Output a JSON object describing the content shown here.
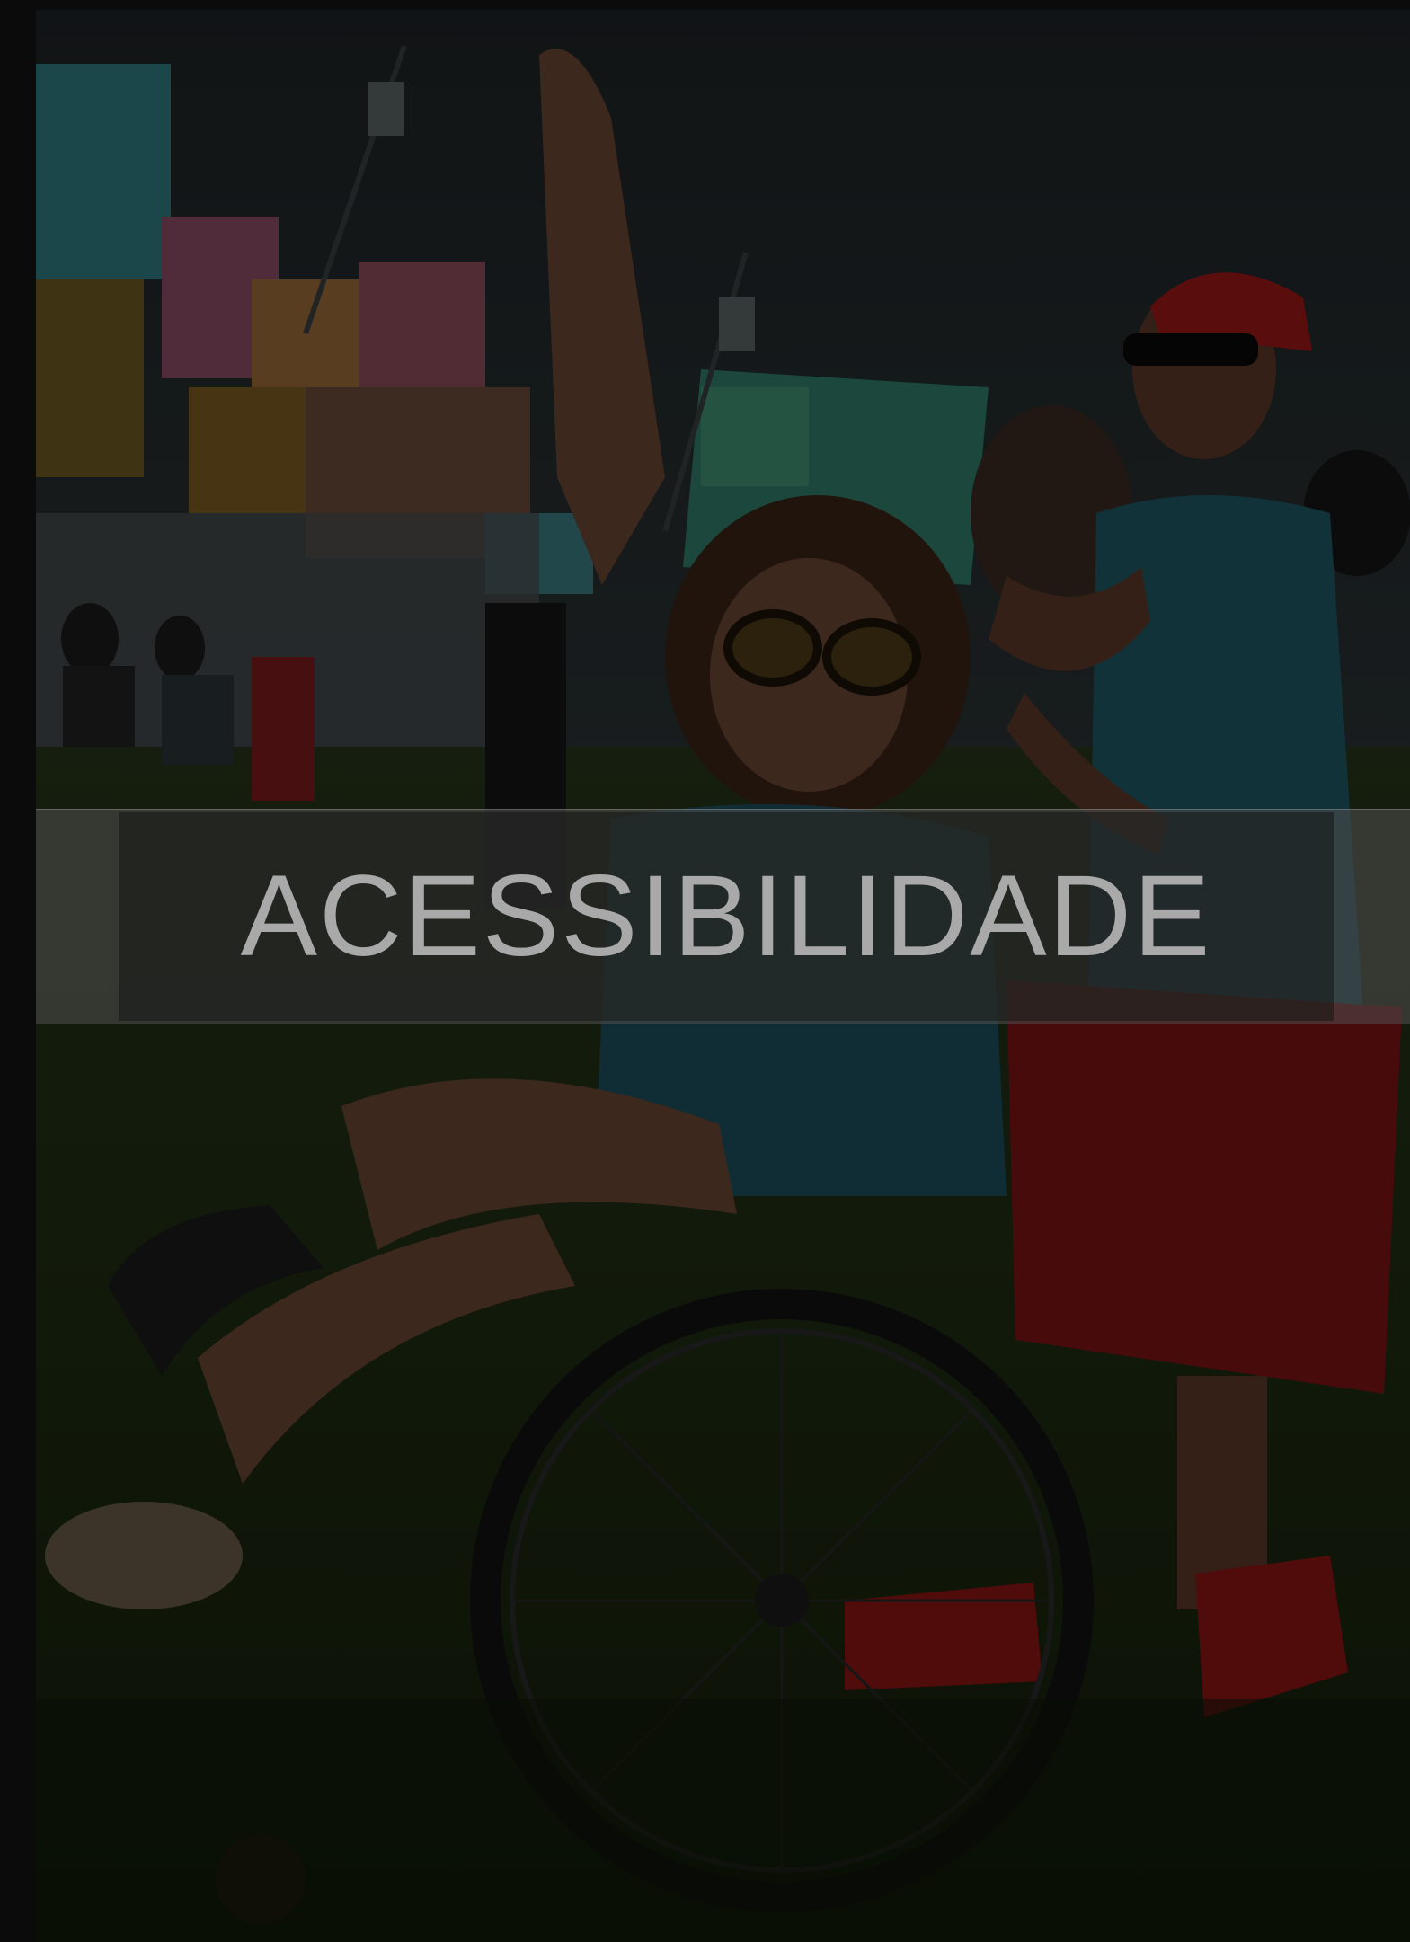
{
  "banner": {
    "title": "ACESSIBILIDADE"
  },
  "photo": {
    "subject": "wheelchair-user-dancing",
    "palette": {
      "sky": "#232a2c",
      "grass": "#1d2a10",
      "shirt_teal": "#1f5664",
      "shorts_red": "#7a1414",
      "skin": "#6a4634",
      "bandana_red": "#9a1818",
      "buildings": [
        "#3a8a8c",
        "#9a5a6a",
        "#a88a3a",
        "#4a9a7a"
      ]
    }
  },
  "colors": {
    "page_background": "#0b0b0b",
    "title_text": "#a9a9a9"
  }
}
